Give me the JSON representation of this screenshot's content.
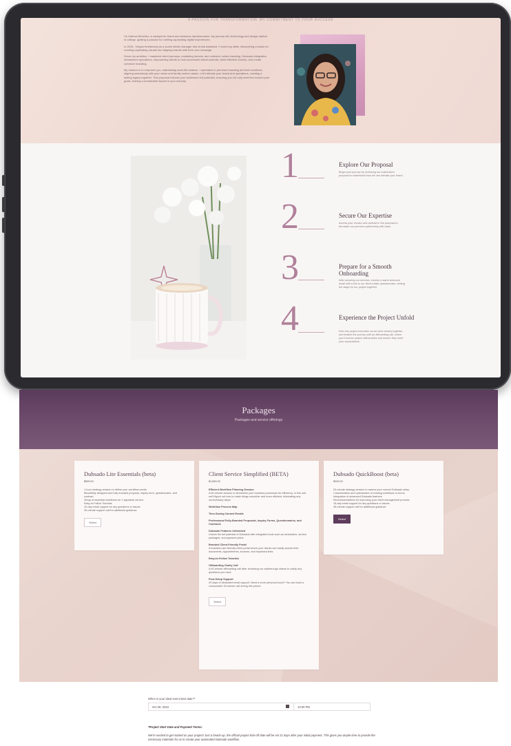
{
  "about": {
    "header": "A PASSION FOR TRANSFORMATION: MY COMMITMENT TO YOUR SUCCESS",
    "paragraphs": [
      "I'm Katrina Mirhenko, a catalyst for brand and business transformation. My journey into technology and design started in college, igniting a passion for crafting captivating digital experiences.",
      "In 2016, I began freelancing as a social media manager and virtual assistant. I honed my skills, discovering a knack for creating captivating visuals and aligning brands with their core message.",
      "Driven by ambition, I mastered client journeys, marketing funnels, and cohesive online branding. Dubsado integration streamlined operations, empowering clients to host successful virtual summits, build effective funnels, and create cohesive branding.",
      "My mission is to empower you, maintaining work-life balance. I specialize in premium branding and tech solutions, aligning seamlessly with your vision and family-centric values. Let's elevate your brand and operations, creating a lasting legacy together. This proposal unlocks your business's full potential, ensuring you not only meet but exceed your goals, leaving a remarkable impact in your industry."
    ]
  },
  "steps": [
    {
      "num": "1",
      "title": "Explore Our Proposal",
      "desc": "Begin your journey by reviewing our customized proposal to understand how we can elevate your brand."
    },
    {
      "num": "2",
      "title": "Secure Our Expertise",
      "desc": "Access your invoice and contract in the proposal to formalize our premium partnership with ease."
    },
    {
      "num": "3",
      "title": "Prepare for a Smooth Onboarding",
      "desc": "After securing our services, receive a warm welcome email with a link to our client intake questionnaire, setting the stage for our project together."
    },
    {
      "num": "4",
      "title": "Experience the Project Unfold",
      "desc": "Dive into project execution as we work closely together, and finalize the journey with an offboarding call, where you'll receive project deliverables and ensure they meet your expectations."
    }
  ],
  "packages": {
    "title": "Packages",
    "subtitle": "Packages and service offerings",
    "cards": [
      {
        "title": "Dubsado Lite Essentials (beta)",
        "price": "$599.00",
        "lines": [
          "1-hour strategy session to define your workflow needs",
          "Beautifully designed and fully branded proposal, inquiry form, questionnaire, and contract",
          "Setup of essential workflows for 1 signature service",
          "Easy-to-Follow Tutorials",
          "10-day email support for any questions or issues",
          "30-minute support call for additional guidance"
        ],
        "button": "Select"
      },
      {
        "title": "Client Service Simplified (BETA)",
        "price": "$1,650.00",
        "features": [
          {
            "title": "Efficient Workflow Planning Session",
            "desc": "A 60-minute session to streamline your business processes for efficiency. In this call, we'll figure out how to make things smoother and more efficient, eliminating any unnecessary steps."
          },
          {
            "title": "Workflow Process Map",
            "desc": ""
          },
          {
            "title": "Time-Saving Canned Emails",
            "desc": ""
          },
          {
            "title": "Professional Fully-Branded Proposals, Inquiry Forms, Questionnaires, and Contracts",
            "desc": ""
          },
          {
            "title": "Dubsado Features Unleashed",
            "desc": "Unlock the full potential of Dubsado with integrated tools such as schedulers, service packages, and payment plans."
          },
          {
            "title": "Branded Client-Friendly Portal",
            "desc": "A branded user-friendly client portal where your clients can easily access their documents, appointments, invoices, and important links."
          },
          {
            "title": "Easy-to-Follow Tutorials",
            "desc": ""
          },
          {
            "title": "Offboarding Clarity Call",
            "desc": "A 60-minute offboarding call after reviewing our walkthrough videos to clarify any questions you have"
          },
          {
            "title": "Post-Setup Support",
            "desc": "20 days of dedicated email support. Need a more personal touch? You can book a consumable 30-minute call during this period"
          }
        ],
        "button": "Select"
      },
      {
        "title": "Dubsado QuickBoost (beta)",
        "price": "$249.00",
        "lines": [
          "20-minute strategy session to assess your current Dubsado setup",
          "Customization and optimization of existing workflows or forms",
          "Integration of advanced Dubsado features",
          "Recommendations for improving your client management process",
          "15-day email support for any questions or issues",
          "45-minute support call for additional guidance"
        ],
        "button": "Select"
      }
    ]
  },
  "form": {
    "label": "When is your ideal event start date?*",
    "date": "Oct 09, 2023",
    "time": "10:00 PM",
    "terms_title": "*Project Start Date and Payment Terms:",
    "terms_text": "We're excited to get started on your project! Just a heads-up, the official project kick-off date will be set 21 days after your initial payment. This gives you ample time to provide the necessary materials for us to create your automated Dubsado workflow."
  },
  "colors": {
    "accent": "#5e3c5c",
    "header_bg": "#6e4d6d",
    "step_number": "#b0809a"
  }
}
